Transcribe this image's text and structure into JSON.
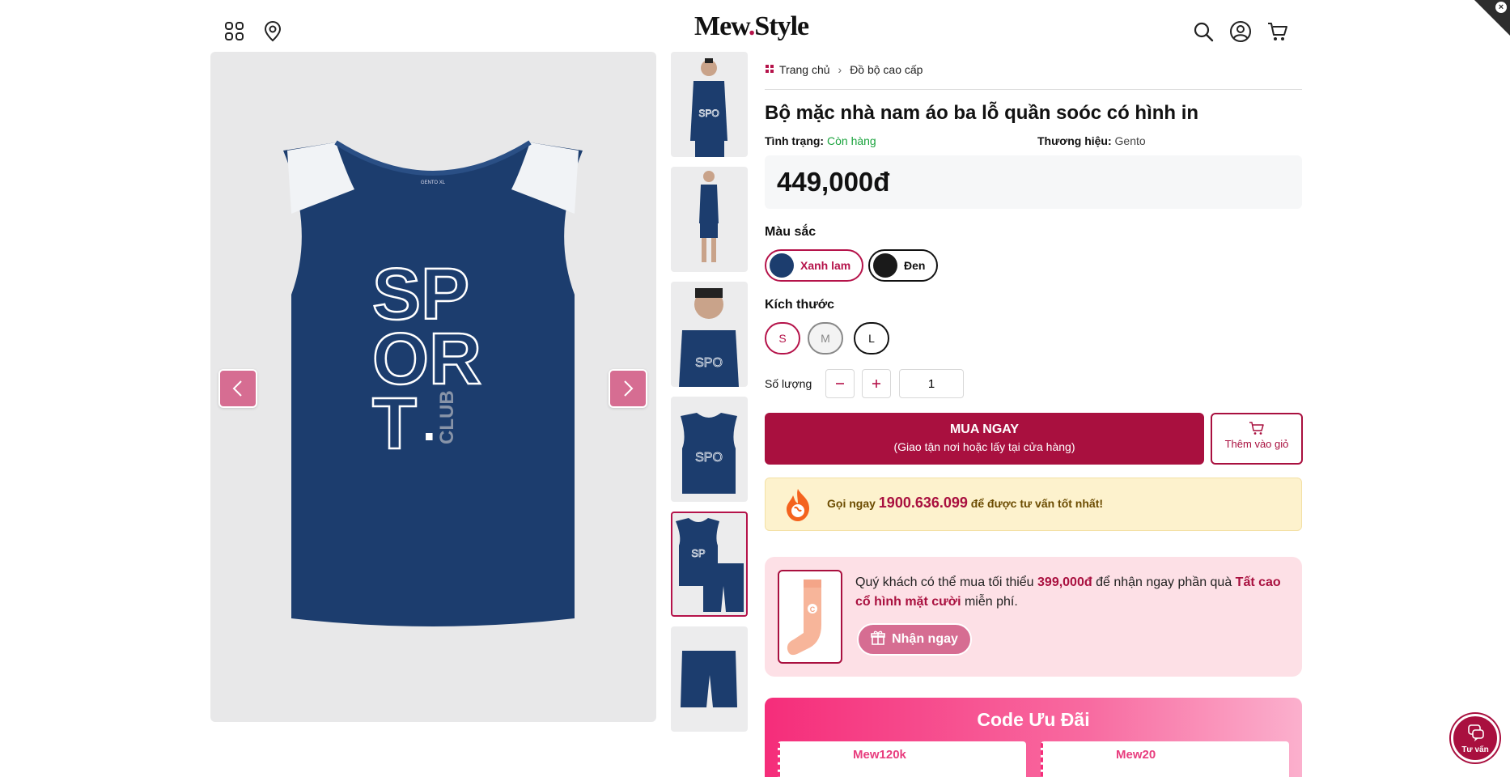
{
  "header": {
    "logo_text": "Mew",
    "logo_dot": ".",
    "logo_text2": "Style"
  },
  "icons": {
    "menu": "grid-menu-icon",
    "location": "location-pin-icon",
    "search": "search-icon",
    "account": "user-icon",
    "cart": "cart-icon"
  },
  "breadcrumb": {
    "home": "Trang chủ",
    "separator": "›",
    "category": "Đồ bộ cao cấp"
  },
  "product": {
    "title": "Bộ mặc nhà nam áo ba lỗ quần soóc có hình in",
    "status_label": "Tình trạng:",
    "status_value": "Còn hàng",
    "brand_label": "Thương hiệu:",
    "brand_value": "Gento",
    "price": "449,000đ",
    "graphic_text": "SPORT.",
    "graphic_sub": "CLUB"
  },
  "color": {
    "label": "Màu sắc",
    "options": [
      {
        "name": "Xanh lam",
        "swatch": "#1c3d6e",
        "selected": true
      },
      {
        "name": "Đen",
        "swatch": "#1a1a1a",
        "selected": false
      }
    ]
  },
  "size": {
    "label": "Kích thước",
    "options": [
      "S",
      "M",
      "L"
    ],
    "selected": "S",
    "disabled": [
      "M"
    ]
  },
  "quantity": {
    "label": "Số lượng",
    "value": "1"
  },
  "actions": {
    "buy_now": "MUA NGAY",
    "buy_now_sub": "(Giao tận nơi hoặc lấy tại cửa hàng)",
    "add_to_cart": "Thêm vào giỏ"
  },
  "hotline": {
    "prefix": "Gọi ngay",
    "number": "1900.636.099",
    "suffix": "để được tư vấn tốt nhất!"
  },
  "gift": {
    "text_1": "Quý khách có thể mua tối thiểu ",
    "min_amount": "399,000đ",
    "text_2": " để nhận ngay phần quà ",
    "gift_name": "Tất cao cổ hình mặt cười",
    "text_3": " miễn phí.",
    "button": "Nhận ngay"
  },
  "coupons": {
    "title": "Code Ưu Đãi",
    "items": [
      {
        "code": "Mew120k"
      },
      {
        "code": "Mew20"
      }
    ]
  },
  "chat": {
    "label": "Tư vấn"
  },
  "colors": {
    "brand": "#a9103f",
    "accent_pink": "#d66d92",
    "product_navy": "#1c3d6e",
    "in_stock_green": "#1aa33d"
  }
}
